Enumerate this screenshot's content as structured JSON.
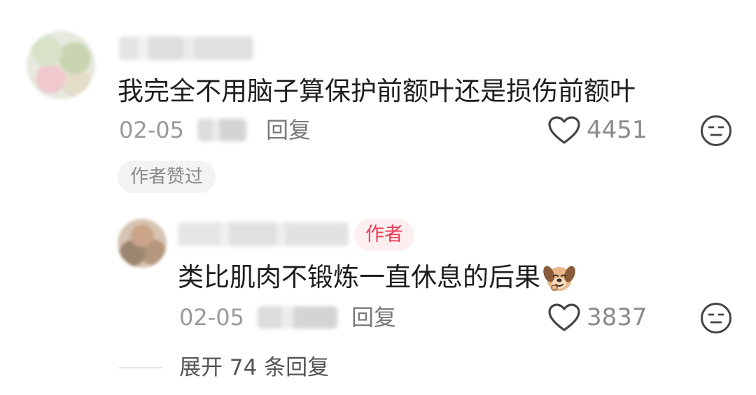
{
  "main_comment": {
    "text": "我完全不用脑子算保护前额叶还是损伤前额叶",
    "date": "02-05",
    "reply_label": "回复",
    "like_count": "4451",
    "author_liked_badge": "作者赞过",
    "icons": {
      "like": "heart-outline-icon",
      "reaction": "expressionless-face-icon"
    }
  },
  "reply_comment": {
    "author_tag": "作者",
    "text": "类比肌肉不锻炼一直休息的后果",
    "date": "02-05",
    "reply_label": "回复",
    "like_count": "3837",
    "icons": {
      "inline_emoji": "dog-face-emoji",
      "like": "heart-outline-icon",
      "reaction": "expressionless-face-icon"
    }
  },
  "expand_replies": {
    "label": "展开 74 条回复"
  },
  "colors": {
    "author_tag_text": "#ec3e58",
    "author_tag_bg": "#fdeef0",
    "meta_text": "#9a9a9a"
  }
}
